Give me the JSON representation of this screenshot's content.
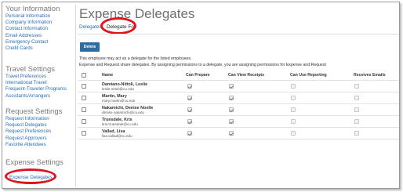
{
  "sidebar": {
    "sections": [
      {
        "title": "Your Information",
        "items": [
          "Personal Information",
          "Company Information",
          "Contact Information",
          "Email Addresses",
          "Emergency Contact",
          "Credit Cards"
        ]
      },
      {
        "title": "Travel Settings",
        "items": [
          "Travel Preferences",
          "International Travel",
          "Frequent-Traveler Programs",
          "Assistants/Arrangers"
        ]
      },
      {
        "title": "Request Settings",
        "items": [
          "Request Information",
          "Request Delegates",
          "Request Preferences",
          "Request Approvers",
          "Favorite Attendees"
        ]
      },
      {
        "title": "Expense Settings",
        "items": []
      }
    ],
    "active_item": "Expense Delegates"
  },
  "main": {
    "title": "Expense Delegates",
    "tabs": [
      "Delegates",
      "Delegate For"
    ],
    "active_tab": "Delegate For",
    "delete_label": "Delete",
    "info_line1": "This employee may act as a delegate for the listed employees.",
    "info_line2": "Expense and Request share delegates. By assigning permissions to a delegate, you are assigning permissions for Expense and Request",
    "columns": [
      "Name",
      "Can Prepare",
      "Can View Receipts",
      "Can Use Reporting",
      "Receives Emails"
    ],
    "rows": [
      {
        "name": "Damiano-Nittoli, Leslie",
        "email": "leslie.nittoli@cu.edu",
        "can_prepare": true,
        "can_view_receipts": true,
        "can_use_reporting": false,
        "receives_emails": false
      },
      {
        "name": "Martin, Mary",
        "email": "mary.martin@cu.edu",
        "can_prepare": true,
        "can_view_receipts": true,
        "can_use_reporting": false,
        "receives_emails": false
      },
      {
        "name": "Nakamichi, Denise Noelle",
        "email": "denise.nakamichi@cu.edu",
        "can_prepare": true,
        "can_view_receipts": true,
        "can_use_reporting": false,
        "receives_emails": false
      },
      {
        "name": "Truesdale, Kris",
        "email": "kris.truesdale@cu.edu",
        "can_prepare": true,
        "can_view_receipts": true,
        "can_use_reporting": false,
        "receives_emails": false
      },
      {
        "name": "Vallad, Lisa",
        "email": "lisa.vallad@cu.edu",
        "can_prepare": true,
        "can_view_receipts": true,
        "can_use_reporting": false,
        "receives_emails": false
      }
    ]
  },
  "colors": {
    "link": "#2a6ebb",
    "highlight": "#e0141e",
    "button": "#2e6da4"
  }
}
